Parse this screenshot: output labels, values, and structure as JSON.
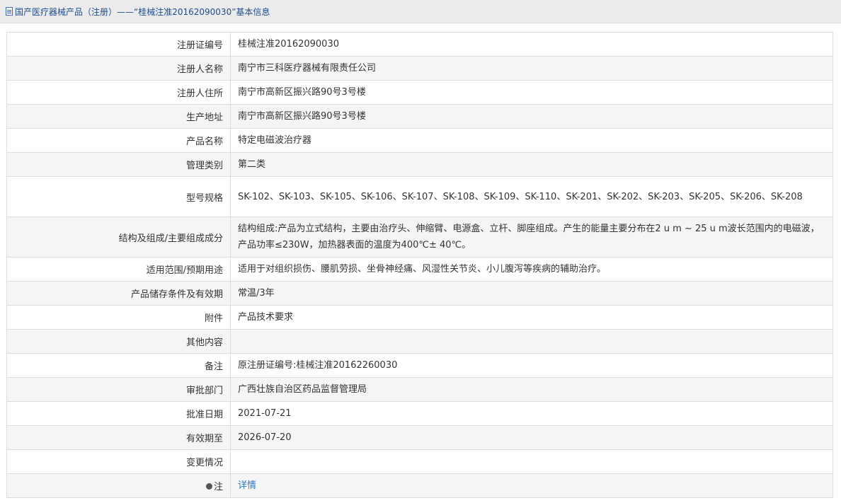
{
  "header": {
    "title": "国产医疗器械产品（注册）——“桂械注准20162090030”基本信息"
  },
  "rows": [
    {
      "label": "注册证编号",
      "value": "桂械注准20162090030"
    },
    {
      "label": "注册人名称",
      "value": "南宁市三科医疗器械有限责任公司"
    },
    {
      "label": "注册人住所",
      "value": "南宁市高新区振兴路90号3号楼"
    },
    {
      "label": "生产地址",
      "value": "南宁市高新区振兴路90号3号楼"
    },
    {
      "label": "产品名称",
      "value": "特定电磁波治疗器"
    },
    {
      "label": "管理类别",
      "value": "第二类"
    },
    {
      "label": "型号规格",
      "value": "SK-102、SK-103、SK-105、SK-106、SK-107、SK-108、SK-109、SK-110、SK-201、SK-202、SK-203、SK-205、SK-206、SK-208"
    },
    {
      "label": "结构及组成/主要组成成分",
      "value": "结构组成:产品为立式结构，主要由治疗头、伸缩臂、电源盒、立杆、脚座组成。产生的能量主要分布在2 u m ~ 25 u m波长范围内的电磁波，产品功率≤230W，加热器表面的温度为400℃± 40℃。"
    },
    {
      "label": "适用范围/预期用途",
      "value": "适用于对组织损伤、腰肌劳损、坐骨神经痛、风湿性关节炎、小儿腹泻等疾病的辅助治疗。"
    },
    {
      "label": "产品储存条件及有效期",
      "value": "常温/3年"
    },
    {
      "label": "附件",
      "value": "产品技术要求"
    },
    {
      "label": "其他内容",
      "value": ""
    },
    {
      "label": "备注",
      "value": "原注册证编号:桂械注准20162260030"
    },
    {
      "label": "审批部门",
      "value": "广西壮族自治区药品监督管理局"
    },
    {
      "label": "批准日期",
      "value": "2021-07-21"
    },
    {
      "label": "有效期至",
      "value": "2026-07-20"
    },
    {
      "label": "变更情况",
      "value": ""
    }
  ],
  "note": {
    "label": "注",
    "link_text": "详情"
  }
}
